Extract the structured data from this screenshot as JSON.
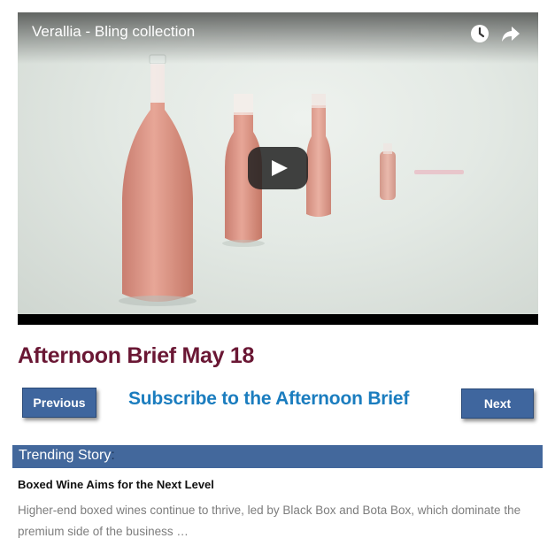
{
  "video": {
    "title": "Verallia - Bling collection",
    "icons": [
      "clock-icon",
      "share-icon",
      "play-icon"
    ]
  },
  "article": {
    "headline": "Afternoon Brief May 18"
  },
  "navigation": {
    "previous_label": "Previous",
    "next_label": "Next",
    "subscribe_text": "Subscribe to the Afternoon Brief"
  },
  "trending": {
    "label": "Trending Story",
    "separator": ":",
    "story_title": "Boxed Wine Aims for the Next Level",
    "story_summary": "Higher-end boxed wines continue to thrive, led by Black Box and Bota Box, which dominate the premium side of the business …"
  },
  "colors": {
    "headline": "#6a1734",
    "button": "#3f669e",
    "subscribe_link": "#1b7dbf",
    "trending_bar": "#43689c"
  }
}
